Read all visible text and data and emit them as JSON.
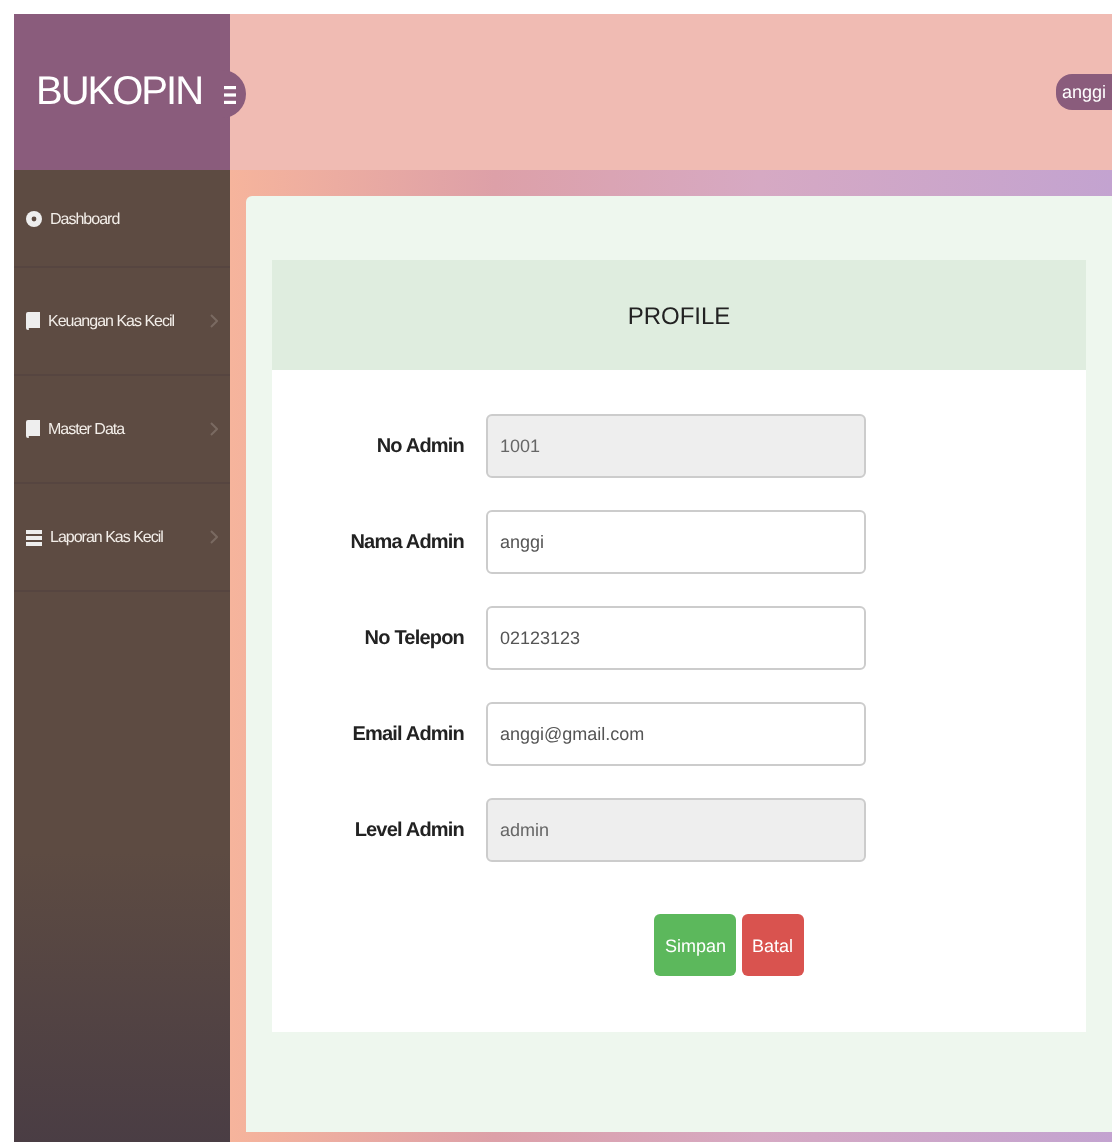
{
  "brand": "BUKOPIN",
  "user_menu": {
    "label": "anggi"
  },
  "sidebar": {
    "items": [
      {
        "label": "Dashboard",
        "kind": "dashboard",
        "has_submenu": false
      },
      {
        "label": "Keuangan Kas Kecil",
        "kind": "book",
        "has_submenu": true
      },
      {
        "label": "Master Data",
        "kind": "book",
        "has_submenu": true
      },
      {
        "label": "Laporan Kas Kecil",
        "kind": "report",
        "has_submenu": true
      }
    ]
  },
  "profile": {
    "title": "PROFILE",
    "fields": [
      {
        "label": "No Admin",
        "value": "1001",
        "disabled": true
      },
      {
        "label": "Nama Admin",
        "value": "anggi",
        "disabled": false
      },
      {
        "label": "No Telepon",
        "value": "02123123",
        "disabled": false
      },
      {
        "label": "Email Admin",
        "value": "anggi@gmail.com",
        "disabled": false
      },
      {
        "label": "Level Admin",
        "value": "admin",
        "disabled": true
      }
    ],
    "buttons": [
      {
        "label": "Simpan",
        "kind": "save"
      },
      {
        "label": "Batal",
        "kind": "cancel"
      }
    ]
  }
}
